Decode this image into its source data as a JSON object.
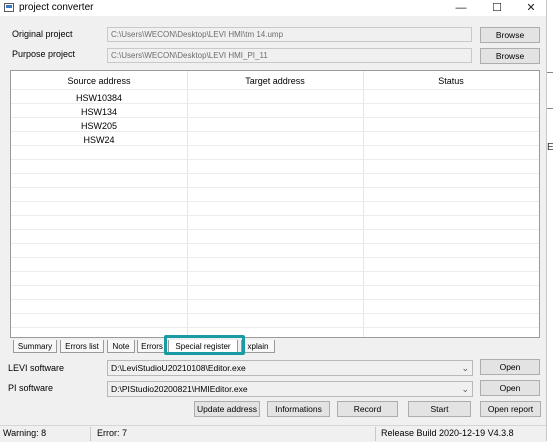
{
  "window": {
    "title": "project converter",
    "min": "—",
    "max": "☐",
    "close": "✕"
  },
  "fields": {
    "original_label": "Original project",
    "original_value": "C:\\Users\\WECON\\Desktop\\LEVI HMI\\tm 14.ump",
    "purpose_label": "Purpose project",
    "purpose_value": "C:\\Users\\WECON\\Desktop\\LEVI HMI_PI_11",
    "browse": "Browse"
  },
  "table": {
    "headers": [
      "Source address",
      "Target address",
      "Status"
    ],
    "rows": [
      {
        "source": "HSW10384"
      },
      {
        "source": "HSW134"
      },
      {
        "source": "HSW205"
      },
      {
        "source": "HSW24"
      }
    ]
  },
  "tabs": [
    "Summary",
    "Errors list",
    "Note",
    "Errors",
    "Special register",
    "xplain"
  ],
  "active_tab": "Special register",
  "software": {
    "levi_label": "LEVI software",
    "levi_path": "D:\\LeviStudioU20210108\\Editor.exe",
    "pi_label": "PI software",
    "pi_path": "D:\\PIStudio20200821\\HMIEditor.exe",
    "open": "Open"
  },
  "actions": {
    "update": "Update address",
    "informations": "Informations",
    "record": "Record",
    "start": "Start",
    "open_report": "Open report"
  },
  "statusbar": {
    "warning": "Warning:  8",
    "error": "Error:  7",
    "release": "Release Build 2020-12-19 V4.3.8"
  },
  "outside_text": "E",
  "colors": {
    "highlight": "#1a9ba3"
  }
}
